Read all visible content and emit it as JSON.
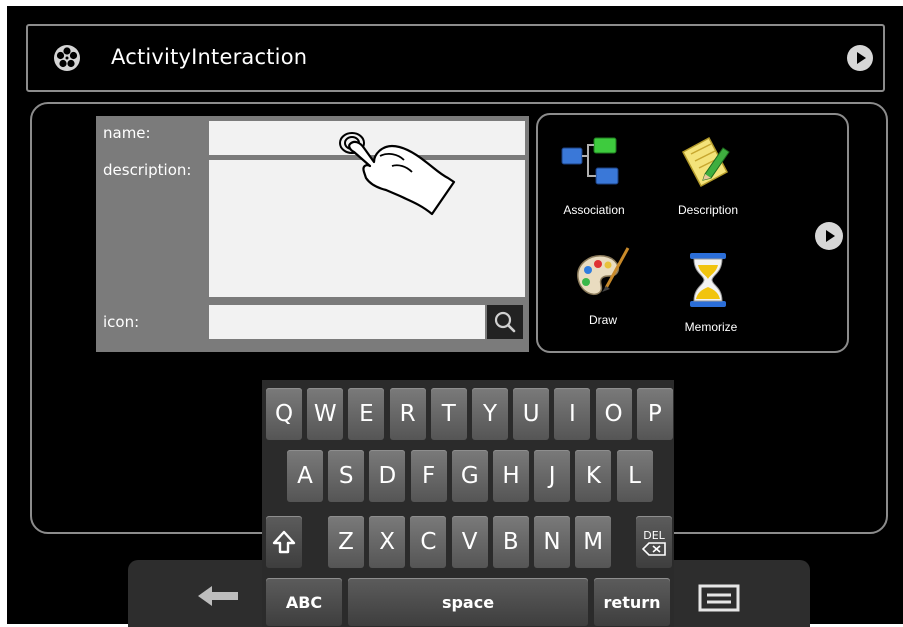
{
  "header": {
    "title": "ActivityInteraction",
    "app_icon": "film-reel-icon",
    "next_icon": "play-arrow-icon"
  },
  "form": {
    "name_label": "name:",
    "name_value": "",
    "description_label": "description:",
    "description_value": "",
    "icon_label": "icon:",
    "icon_value": "",
    "search_icon": "magnifier-icon"
  },
  "activities": {
    "items": [
      {
        "label": "Association",
        "icon": "association-icon"
      },
      {
        "label": "Description",
        "icon": "notepad-pencil-icon"
      },
      {
        "label": "Draw",
        "icon": "palette-icon"
      },
      {
        "label": "Memorize",
        "icon": "hourglass-icon"
      }
    ],
    "next_icon": "play-arrow-icon"
  },
  "keyboard": {
    "row1": [
      "Q",
      "W",
      "E",
      "R",
      "T",
      "Y",
      "U",
      "I",
      "O",
      "P"
    ],
    "row2": [
      "A",
      "S",
      "D",
      "F",
      "G",
      "H",
      "J",
      "K",
      "L"
    ],
    "row3": [
      "Z",
      "X",
      "C",
      "V",
      "B",
      "N",
      "M"
    ],
    "del_label": "DEL",
    "abc_label": "ABC",
    "space_label": "space",
    "return_label": "return"
  },
  "colors": {
    "background": "#000000",
    "border": "#8c8c8c",
    "form_panel": "#7b7b7b",
    "field": "#f2f2f2",
    "key": "#6a6a6a"
  }
}
